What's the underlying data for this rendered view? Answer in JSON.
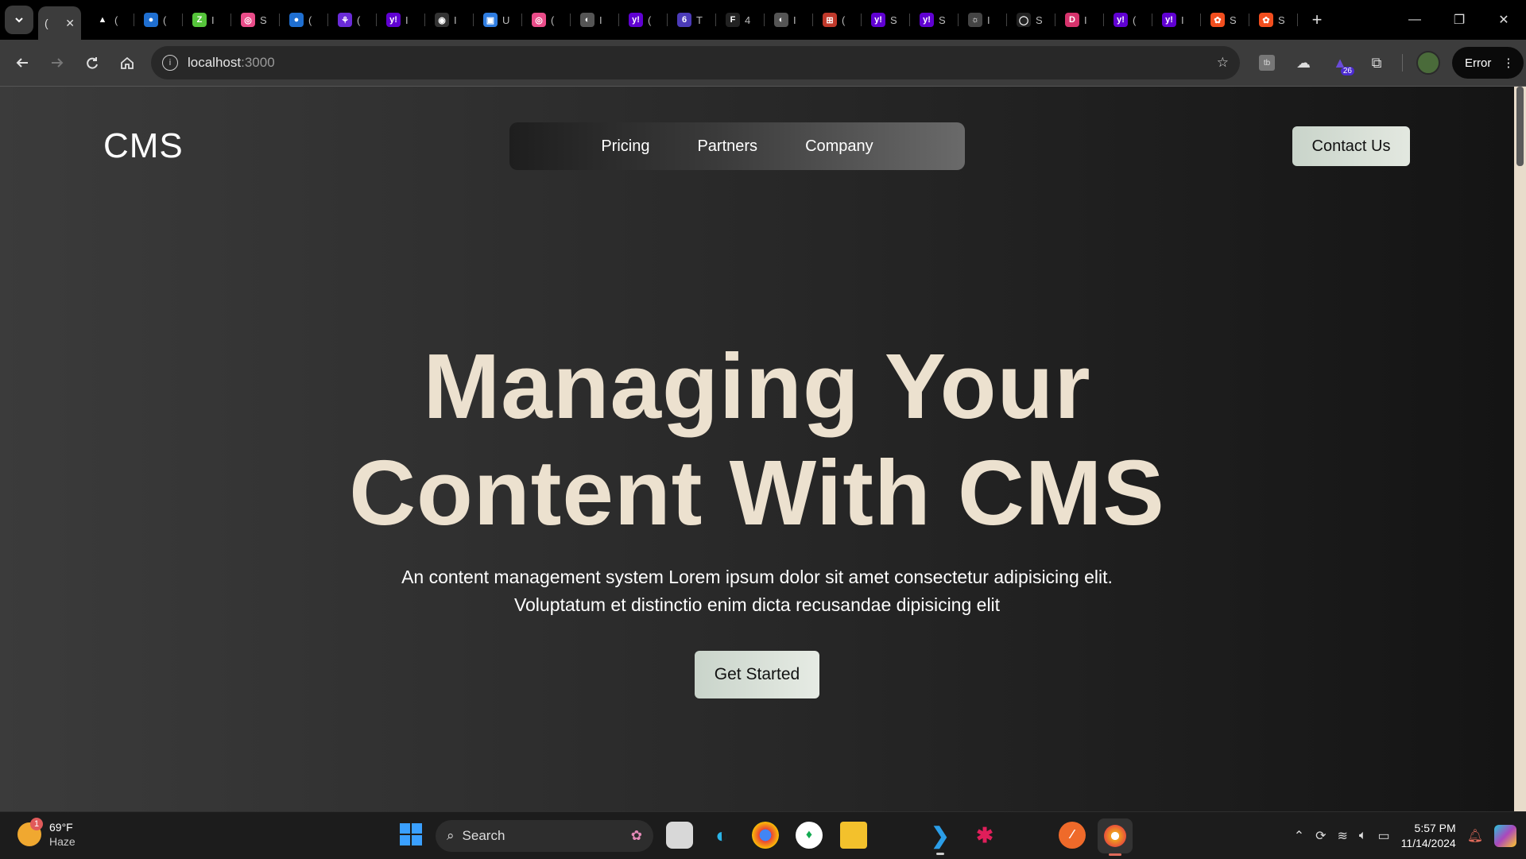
{
  "browser": {
    "active_tab_label": "(",
    "tabs": [
      {
        "icon": "triangle-icon",
        "label": "(",
        "color": "#000000",
        "glyph": "▲"
      },
      {
        "icon": "globe-blue-icon",
        "label": "(",
        "color": "#1f6fd1",
        "glyph": "●"
      },
      {
        "icon": "green-app-icon",
        "label": "I",
        "color": "#55c43a",
        "glyph": "Z"
      },
      {
        "icon": "dribbble-icon",
        "label": "S",
        "color": "#ea4c89",
        "glyph": "◎"
      },
      {
        "icon": "globe-blue-icon",
        "label": "(",
        "color": "#1f6fd1",
        "glyph": "●"
      },
      {
        "icon": "purple-app-icon",
        "label": "(",
        "color": "#6a2bd8",
        "glyph": "⚘"
      },
      {
        "icon": "yahoo-icon",
        "label": "I",
        "color": "#6001d2",
        "glyph": "y!"
      },
      {
        "icon": "circle-app-icon",
        "label": "I",
        "color": "#333333",
        "glyph": "◉"
      },
      {
        "icon": "blue-app-icon",
        "label": "U",
        "color": "#2f7de1",
        "glyph": "▣"
      },
      {
        "icon": "dribbble-icon",
        "label": "(",
        "color": "#ea4c89",
        "glyph": "◎"
      },
      {
        "icon": "globe-grey-icon",
        "label": "I",
        "color": "#555555",
        "glyph": "◐"
      },
      {
        "icon": "yahoo-icon",
        "label": "(",
        "color": "#6001d2",
        "glyph": "y!"
      },
      {
        "icon": "six-icon",
        "label": "T",
        "color": "#4b3bb8",
        "glyph": "6"
      },
      {
        "icon": "f-app-icon",
        "label": "4",
        "color": "#222222",
        "glyph": "F"
      },
      {
        "icon": "globe-grey-icon",
        "label": "I",
        "color": "#555555",
        "glyph": "◐"
      },
      {
        "icon": "grid-app-icon",
        "label": "(",
        "color": "#c0392b",
        "glyph": "⊞"
      },
      {
        "icon": "yahoo-icon",
        "label": "S",
        "color": "#6001d2",
        "glyph": "y!"
      },
      {
        "icon": "yahoo-icon",
        "label": "S",
        "color": "#6001d2",
        "glyph": "y!"
      },
      {
        "icon": "lightbulb-icon",
        "label": "I",
        "color": "#444444",
        "glyph": "☼"
      },
      {
        "icon": "github-icon",
        "label": "S",
        "color": "#222222",
        "glyph": "◯"
      },
      {
        "icon": "d-app-icon",
        "label": "I",
        "color": "#d6336c",
        "glyph": "D"
      },
      {
        "icon": "yahoo-icon",
        "label": "(",
        "color": "#6001d2",
        "glyph": "y!"
      },
      {
        "icon": "yahoo-icon",
        "label": "I",
        "color": "#6001d2",
        "glyph": "y!"
      },
      {
        "icon": "figma-icon",
        "label": "S",
        "color": "#f24e1e",
        "glyph": "✿"
      },
      {
        "icon": "figma-icon",
        "label": "S",
        "color": "#f24e1e",
        "glyph": "✿"
      }
    ],
    "url_host": "localhost",
    "url_port": ":3000",
    "extension_badge": "26",
    "error_chip": "Error"
  },
  "site": {
    "logo": "CMS",
    "nav": [
      "Pricing",
      "Partners",
      "Company"
    ],
    "contact_button": "Contact Us",
    "hero_line1": "Managing Your",
    "hero_line2": "Content With CMS",
    "hero_sub_line1": "An content management system Lorem ipsum dolor sit amet consectetur adipisicing elit.",
    "hero_sub_line2": "Voluptatum et distinctio enim dicta recusandae dipisicing elit",
    "cta_button": "Get Started"
  },
  "taskbar": {
    "weather_badge": "1",
    "weather_temp": "69°F",
    "weather_desc": "Haze",
    "search_label": "Search",
    "time": "5:57 PM",
    "date": "11/14/2024"
  },
  "colors": {
    "hero_text": "#ece1cf",
    "button_bg": "#d4ddd3",
    "scrollbar_track": "#e8dccb"
  }
}
